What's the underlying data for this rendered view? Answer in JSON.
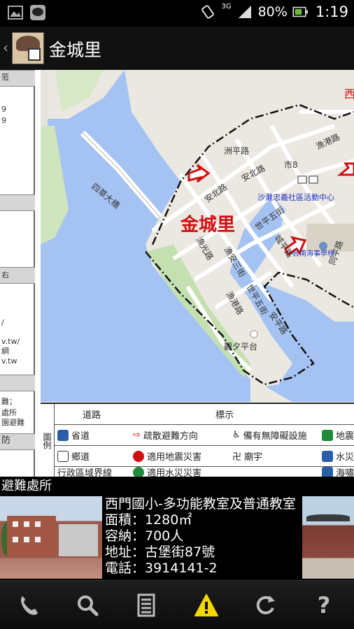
{
  "status_bar": {
    "network": "3G",
    "battery": "80%",
    "time": "1:19",
    "icons": [
      "gallery-icon",
      "line-app-icon",
      "vibrate-icon",
      "signal-icon",
      "battery-icon"
    ]
  },
  "header": {
    "title": "金城里",
    "back_icon": "chevron-left-icon"
  },
  "map": {
    "place_label": "金城里",
    "roads": [
      "四草大橋",
      "安北路",
      "安北路",
      "洲平路",
      "世平五街",
      "城平路",
      "漁光路",
      "漁安三街",
      "漁港路",
      "世平五街",
      "安平路",
      "同平路",
      "漁港路"
    ],
    "poi_labels": [
      "沙灘忠義社區活動中心",
      "台南海事學校",
      "觀夕平台",
      "市8",
      "西"
    ],
    "left_panel_fragments": [
      "蒞",
      "9",
      "9",
      "右",
      "/",
      "v.tw/",
      "網",
      "v.tw",
      "難；",
      "處所",
      "園避難",
      "防"
    ]
  },
  "legend": {
    "section_label": "圖例",
    "column_headers": [
      "道路",
      "標示"
    ],
    "rows": [
      {
        "road": "省道",
        "marks": [
          "疏散避難方向",
          "備有無障礙設施",
          "地震"
        ]
      },
      {
        "road": "鄉道",
        "marks": [
          "適用地震災害",
          "廟宇",
          "水災"
        ]
      },
      {
        "road": "行政區域界線",
        "marks": [
          "適用水災災害",
          "",
          "海嘯"
        ]
      }
    ]
  },
  "shelter": {
    "section_title": "避難處所",
    "name": "西門國小-多功能教室及普通教室",
    "area": "面積：1280㎡",
    "capacity": "容納：700人",
    "address": "地址：古堡街87號",
    "phone": "電話：3914141-2"
  },
  "bottom_nav": [
    {
      "name": "phone-icon",
      "label": "call"
    },
    {
      "name": "search-icon",
      "label": "search"
    },
    {
      "name": "list-icon",
      "label": "list"
    },
    {
      "name": "warning-icon",
      "label": "alert"
    },
    {
      "name": "refresh-icon",
      "label": "refresh"
    },
    {
      "name": "help-icon",
      "label": "help"
    }
  ],
  "colors": {
    "water": "#a4c3f2",
    "land": "#ebe8e1",
    "road": "#ffffff",
    "label_red": "#d01010",
    "warning_yellow": "#f5d600"
  }
}
